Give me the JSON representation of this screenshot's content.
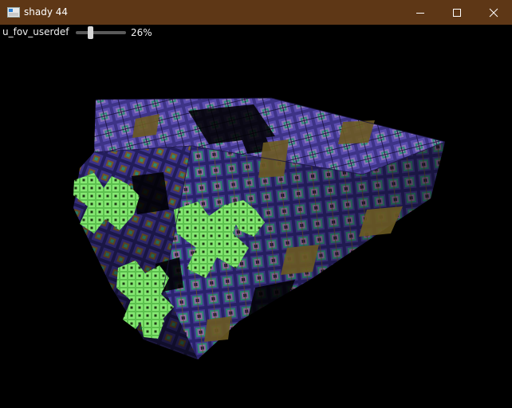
{
  "window": {
    "title": "shady 44",
    "titlebar_color": "#5e3716",
    "app_icon": "app-window-icon",
    "controls": {
      "minimize_icon": "minimize-icon",
      "maximize_icon": "maximize-icon",
      "close_icon": "close-icon"
    }
  },
  "params": {
    "fov": {
      "label": "u_fov_userdef",
      "value_text": "26%",
      "value_fraction": 0.26
    }
  },
  "render": {
    "subject": "menger-sponge-fractal-render",
    "colors": {
      "background": "#000000",
      "purple": "#4a3d9a",
      "teal": "#2f8f7a",
      "pink": "#b07ab0",
      "green": "#7fe36a",
      "olive": "#6b5a22"
    }
  }
}
